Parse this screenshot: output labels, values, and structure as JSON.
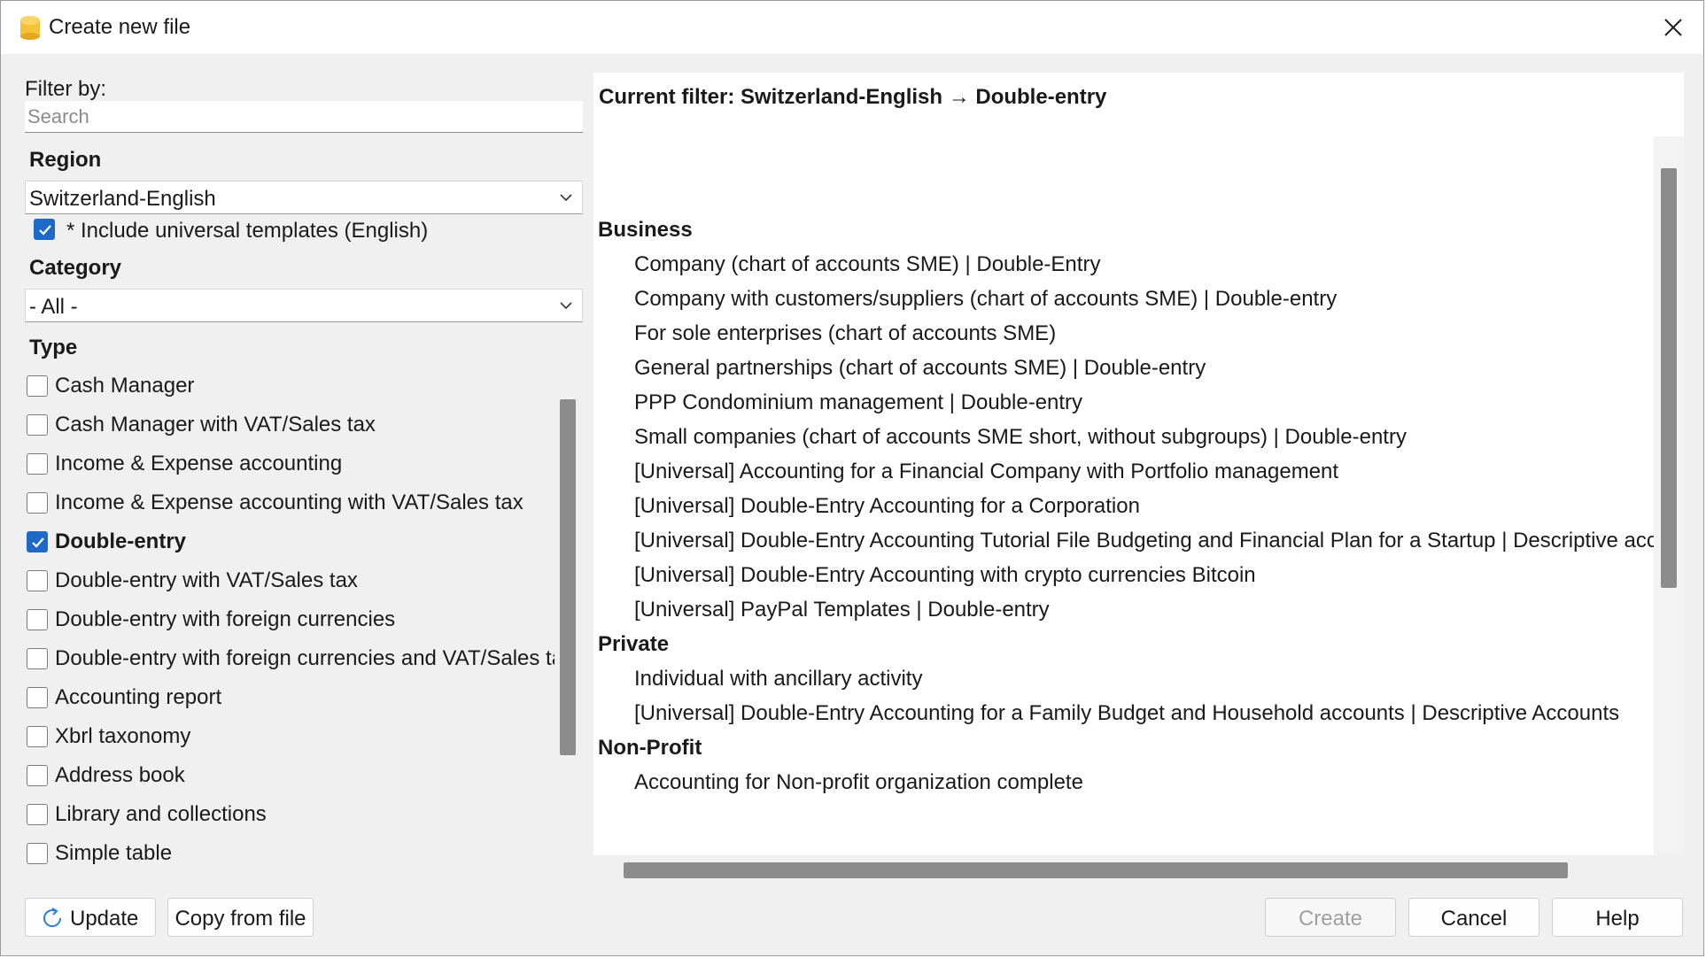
{
  "window": {
    "title": "Create new file"
  },
  "filter": {
    "label": "Filter by:",
    "search_placeholder": "Search",
    "region_label": "Region",
    "region_value": "Switzerland-English",
    "include_universal_label": "* Include universal templates (English)",
    "include_universal_checked": true,
    "category_label": "Category",
    "category_value": "- All -",
    "type_label": "Type"
  },
  "types": [
    {
      "label": "Cash Manager",
      "checked": false
    },
    {
      "label": "Cash Manager with VAT/Sales tax",
      "checked": false
    },
    {
      "label": "Income & Expense accounting",
      "checked": false
    },
    {
      "label": "Income & Expense accounting with VAT/Sales tax",
      "checked": false
    },
    {
      "label": "Double-entry",
      "checked": true
    },
    {
      "label": "Double-entry with VAT/Sales tax",
      "checked": false
    },
    {
      "label": "Double-entry with foreign currencies",
      "checked": false
    },
    {
      "label": "Double-entry with foreign currencies and VAT/Sales tax",
      "checked": false
    },
    {
      "label": "Accounting report",
      "checked": false
    },
    {
      "label": "Xbrl taxonomy",
      "checked": false
    },
    {
      "label": "Address book",
      "checked": false
    },
    {
      "label": "Library and collections",
      "checked": false
    },
    {
      "label": "Simple table",
      "checked": false
    }
  ],
  "current_filter": "Current filter: Switzerland-English → Double-entry",
  "templates": {
    "business": {
      "title": "Business",
      "items": [
        "Company (chart of accounts SME) | Double-Entry",
        "Company with customers/suppliers (chart of accounts SME) | Double-entry",
        "For sole enterprises (chart of accounts SME)",
        "General partnerships (chart of accounts SME) | Double-entry",
        "PPP Condominium management | Double-entry",
        "Small companies (chart of accounts SME short, without subgroups) | Double-entry",
        "[Universal] Accounting for a Financial Company with Portfolio management",
        "[Universal] Double-Entry Accounting for a Corporation",
        "[Universal] Double-Entry Accounting Tutorial File Budgeting and Financial Plan for a Startup | Descriptive accounts",
        "[Universal] Double-Entry Accounting with crypto currencies Bitcoin",
        "[Universal] PayPal Templates | Double-entry"
      ]
    },
    "private": {
      "title": "Private",
      "items": [
        "Individual with ancillary activity",
        "[Universal] Double-Entry Accounting for a Family Budget and Household accounts | Descriptive Accounts"
      ]
    },
    "nonprofit": {
      "title": "Non-Profit",
      "items": [
        "Accounting for Non-profit organization complete"
      ]
    }
  },
  "buttons": {
    "update": "Update",
    "copy_from_file": "Copy from file",
    "create": "Create",
    "cancel": "Cancel",
    "help": "Help"
  },
  "colors": {
    "accent": "#1f6ac9",
    "app_icon": "#f5c33b"
  }
}
